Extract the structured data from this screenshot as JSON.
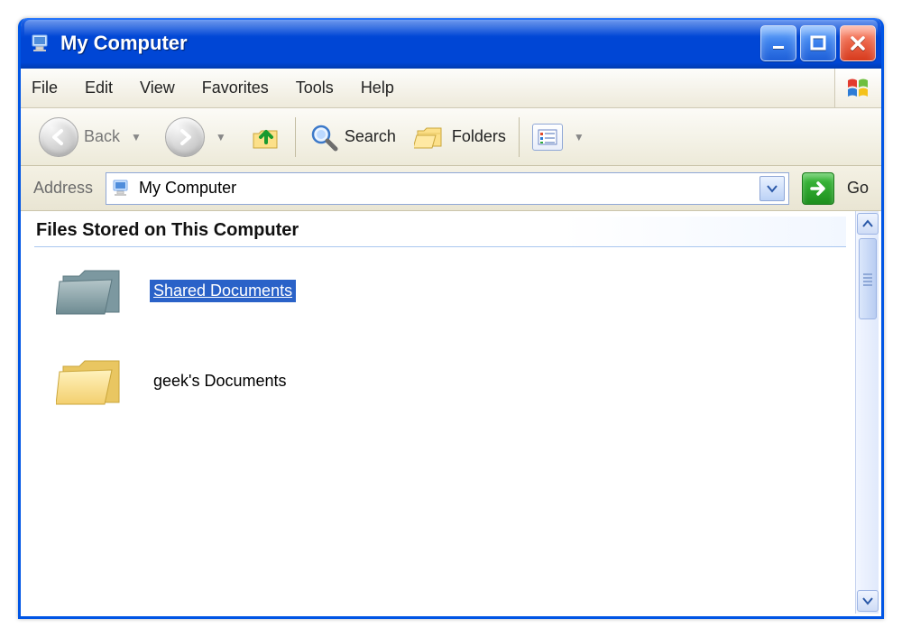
{
  "window": {
    "title": "My Computer"
  },
  "menu": {
    "file": "File",
    "edit": "Edit",
    "view": "View",
    "favorites": "Favorites",
    "tools": "Tools",
    "help": "Help"
  },
  "toolbar": {
    "back": "Back",
    "search": "Search",
    "folders": "Folders"
  },
  "address": {
    "label": "Address",
    "value": "My Computer",
    "go": "Go"
  },
  "content": {
    "section_title": "Files Stored on This Computer",
    "items": [
      {
        "label": "Shared Documents",
        "selected": true,
        "icon": "folder-shared"
      },
      {
        "label": "geek's Documents",
        "selected": false,
        "icon": "folder"
      }
    ]
  }
}
